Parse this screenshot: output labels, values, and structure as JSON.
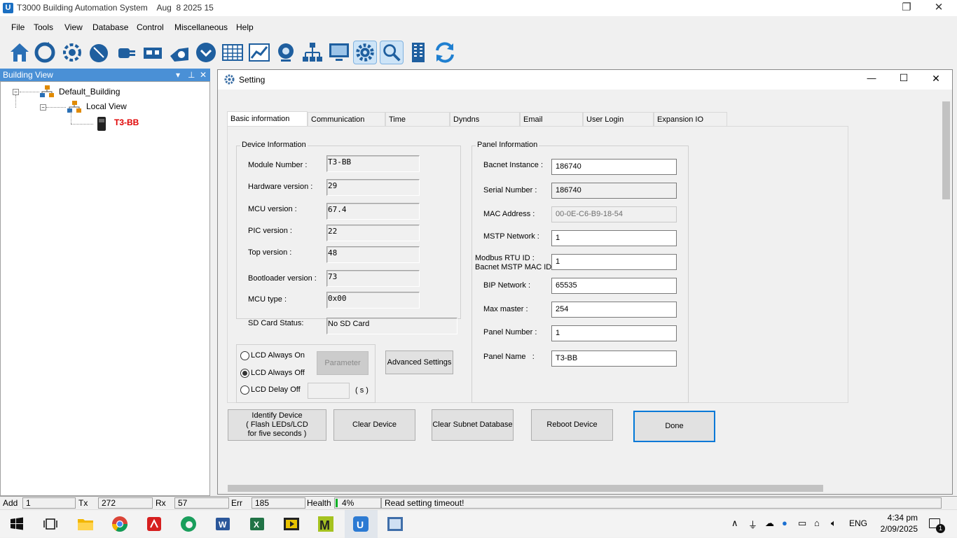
{
  "window": {
    "title": "T3000 Building Automation System    Aug  8 2025 15",
    "app_icon": "app-logo-icon",
    "restore_glyph": "❐",
    "close_glyph": "✕"
  },
  "menu": {
    "items": [
      "File",
      "Tools",
      "View",
      "Database",
      "Control",
      "Miscellaneous",
      "Help"
    ]
  },
  "toolbar": {
    "icons": [
      "home-icon",
      "refresh-cycle-icon",
      "scan-gear-icon",
      "globe-icon",
      "plug-icon",
      "network-device-icon",
      "fan-icon",
      "dropdown-circle-icon",
      "grid-table-icon",
      "chart-icon",
      "webcam-icon",
      "hierarchy-icon",
      "monitor-icon",
      "settings-gear-icon",
      "search-icon",
      "building-icon",
      "sync-arrows-icon"
    ],
    "active": [
      "settings-gear-icon",
      "search-icon"
    ]
  },
  "building_view": {
    "title": "Building View",
    "controls": {
      "dropdown": "▾",
      "pin": "⊥",
      "close": "✕"
    },
    "tree": {
      "root": "Default_Building",
      "child": "Local View",
      "device": "T3-BB",
      "device_color": "#e00000"
    }
  },
  "dialog": {
    "title": "Setting",
    "controls": {
      "minimize": "—",
      "maximize": "☐",
      "close": "✕"
    },
    "tabs": [
      "Basic information",
      "Communication",
      "Time",
      "Dyndns",
      "Email",
      "User Login",
      "Expansion IO"
    ],
    "active_tab": "Basic information",
    "device_info": {
      "title": "Device Information",
      "fields": [
        {
          "label": "Module Number :",
          "value": "T3-BB"
        },
        {
          "label": "Hardware version :",
          "value": "29"
        },
        {
          "label": "MCU version :",
          "value": "67.4"
        },
        {
          "label": "PIC version :",
          "value": "22"
        },
        {
          "label": "Top version :",
          "value": "48"
        },
        {
          "label": "Bootloader version :",
          "value": "73"
        },
        {
          "label": "MCU type :",
          "value": "0x00"
        },
        {
          "label": "SD Card Status:",
          "value": "No SD Card"
        }
      ]
    },
    "lcd": {
      "options": [
        "LCD Always On",
        "LCD Always Off",
        "LCD Delay Off"
      ],
      "selected": "LCD Always Off",
      "parameter_button": "Parameter",
      "delay_value": "",
      "unit": "( s )"
    },
    "advanced_button": "Advanced Settings",
    "panel_info": {
      "title": "Panel Information",
      "fields": [
        {
          "label": "Bacnet Instance :",
          "value": "186740"
        },
        {
          "label": "Serial Number :",
          "value": "186740"
        },
        {
          "label": "MAC Address :",
          "value": "00-0E-C6-B9-18-54"
        },
        {
          "label": "MSTP Network :",
          "value": "1"
        },
        {
          "label": "Modbus RTU ID :",
          "label2": "Bacnet MSTP MAC ID:",
          "value": "1"
        },
        {
          "label": "BIP Network :",
          "value": "65535"
        },
        {
          "label": "Max master :",
          "value": "254"
        },
        {
          "label": "Panel Number :",
          "value": "1"
        },
        {
          "label": "Panel Name   :",
          "value": "T3-BB"
        }
      ]
    },
    "buttons": {
      "identify": [
        "Identify Device",
        "( Flash LEDs/LCD",
        "for five seconds )"
      ],
      "clear_device": "Clear Device",
      "clear_subnet": "Clear Subnet Database",
      "reboot": "Reboot Device",
      "done": "Done"
    }
  },
  "statusbar": {
    "add_label": "Add",
    "add_value": "1",
    "tx_label": "Tx",
    "tx_value": "272",
    "rx_label": "Rx",
    "rx_value": "57",
    "err_label": "Err",
    "err_value": "185",
    "health_label": "Health",
    "health_value": "4%",
    "health_level": 4,
    "message": "Read setting timeout!"
  },
  "taskbar": {
    "apps": [
      "windows-start-icon",
      "task-view-icon",
      "file-explorer-icon",
      "chrome-icon",
      "acrobat-icon",
      "edge-icon",
      "word-icon",
      "excel-icon",
      "media-player-icon",
      "m-app-icon",
      "t3000-icon",
      "remote-app-icon"
    ],
    "lang": "ENG",
    "time": "4:34 pm",
    "date": "2/09/2025",
    "notification_count": "1"
  }
}
